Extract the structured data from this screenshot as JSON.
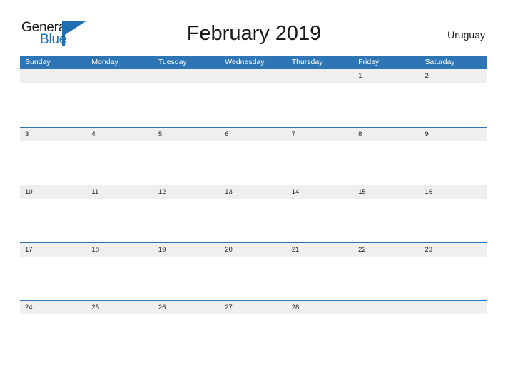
{
  "branding": {
    "name_top": "General",
    "name_bottom": "Blue",
    "accent_color": "#1f6fb4"
  },
  "header": {
    "title": "February 2019",
    "country": "Uruguay"
  },
  "calendar": {
    "header_color": "#2e75b6",
    "band_color": "#efefef",
    "weekdays": [
      "Sunday",
      "Monday",
      "Tuesday",
      "Wednesday",
      "Thursday",
      "Friday",
      "Saturday"
    ],
    "weeks": [
      [
        "",
        "",
        "",
        "",
        "",
        "1",
        "2"
      ],
      [
        "3",
        "4",
        "5",
        "6",
        "7",
        "8",
        "9"
      ],
      [
        "10",
        "11",
        "12",
        "13",
        "14",
        "15",
        "16"
      ],
      [
        "17",
        "18",
        "19",
        "20",
        "21",
        "22",
        "23"
      ],
      [
        "24",
        "25",
        "26",
        "27",
        "28",
        "",
        ""
      ]
    ]
  }
}
